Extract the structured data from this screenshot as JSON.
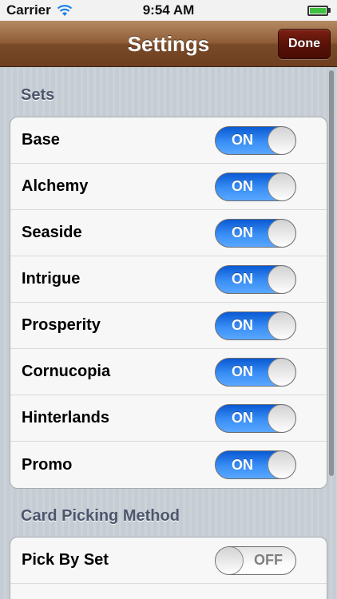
{
  "status_bar": {
    "carrier": "Carrier",
    "time": "9:54 AM",
    "wifi_icon": "wifi-icon",
    "battery_icon": "battery-icon",
    "battery_color": "#3ec13e"
  },
  "nav_bar": {
    "title": "Settings",
    "done_label": "Done"
  },
  "sections": {
    "sets": {
      "header": "Sets",
      "items": [
        {
          "label": "Base",
          "state": "ON"
        },
        {
          "label": "Alchemy",
          "state": "ON"
        },
        {
          "label": "Seaside",
          "state": "ON"
        },
        {
          "label": "Intrigue",
          "state": "ON"
        },
        {
          "label": "Prosperity",
          "state": "ON"
        },
        {
          "label": "Cornucopia",
          "state": "ON"
        },
        {
          "label": "Hinterlands",
          "state": "ON"
        },
        {
          "label": "Promo",
          "state": "ON"
        }
      ]
    },
    "card_picking": {
      "header": "Card Picking Method",
      "items": [
        {
          "label": "Pick By Set",
          "state": "OFF"
        }
      ]
    }
  },
  "colors": {
    "switch_on": "#3a8ff5",
    "nav_brown": "#8e5c37",
    "done_button": "#5a1208"
  }
}
